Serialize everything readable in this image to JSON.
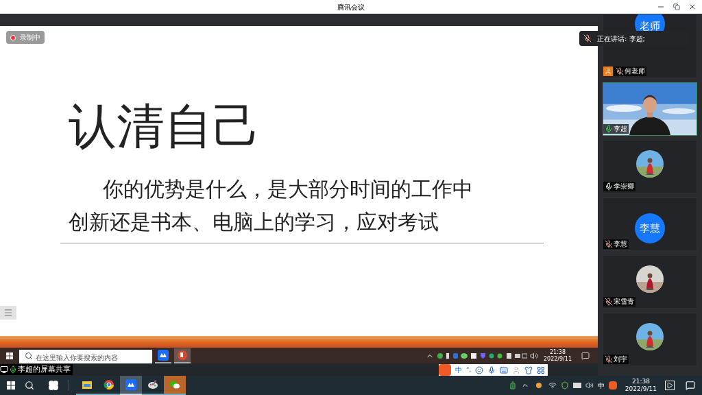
{
  "window": {
    "title": "腾讯会议"
  },
  "recording": {
    "label": "录制中"
  },
  "speaking": {
    "label": "正在讲话: 李超;"
  },
  "slide": {
    "title": "认清自己",
    "lines": [
      "你的优势是什么，是大部分时间的工作中",
      "创新还是书本、电脑上的学习，应对考试"
    ]
  },
  "participants": [
    {
      "name": "何老师",
      "kind": "avatar",
      "avatar_text": "老师",
      "muted": true,
      "speaking": false,
      "host": true
    },
    {
      "name": "李超",
      "kind": "video",
      "muted": false,
      "speaking": true,
      "host": false
    },
    {
      "name": "李崇卿",
      "muted": false,
      "speaking": false,
      "host": false
    },
    {
      "name": "李慧",
      "kind": "avatar",
      "avatar_text": "李慧",
      "muted": true,
      "speaking": false,
      "host": false
    },
    {
      "name": "宋雪青",
      "muted": true,
      "speaking": false,
      "host": false
    },
    {
      "name": "刘宇",
      "muted": true,
      "speaking": false,
      "host": false
    }
  ],
  "remote_taskbar": {
    "search": {
      "placeholder": "在这里输入你要搜索的内容"
    },
    "apps": [
      {
        "kind": "meeting",
        "selected": false
      },
      {
        "kind": "slides",
        "selected": true
      }
    ],
    "time": "21:38",
    "date": "2022/9/11"
  },
  "share_label": "李超的屏幕共享",
  "ime": {
    "mode": "中",
    "punct": "°,"
  },
  "taskbar": {
    "apps": [
      {
        "kind": "folder",
        "selected": false,
        "attention": false
      },
      {
        "kind": "browser",
        "selected": false,
        "attention": false
      },
      {
        "kind": "meeting",
        "selected": true,
        "attention": false
      },
      {
        "kind": "paint",
        "selected": false,
        "attention": false
      },
      {
        "kind": "chat",
        "selected": false,
        "attention": true
      }
    ],
    "ime": "中",
    "time": "21:38",
    "date": "2022/9/11"
  }
}
